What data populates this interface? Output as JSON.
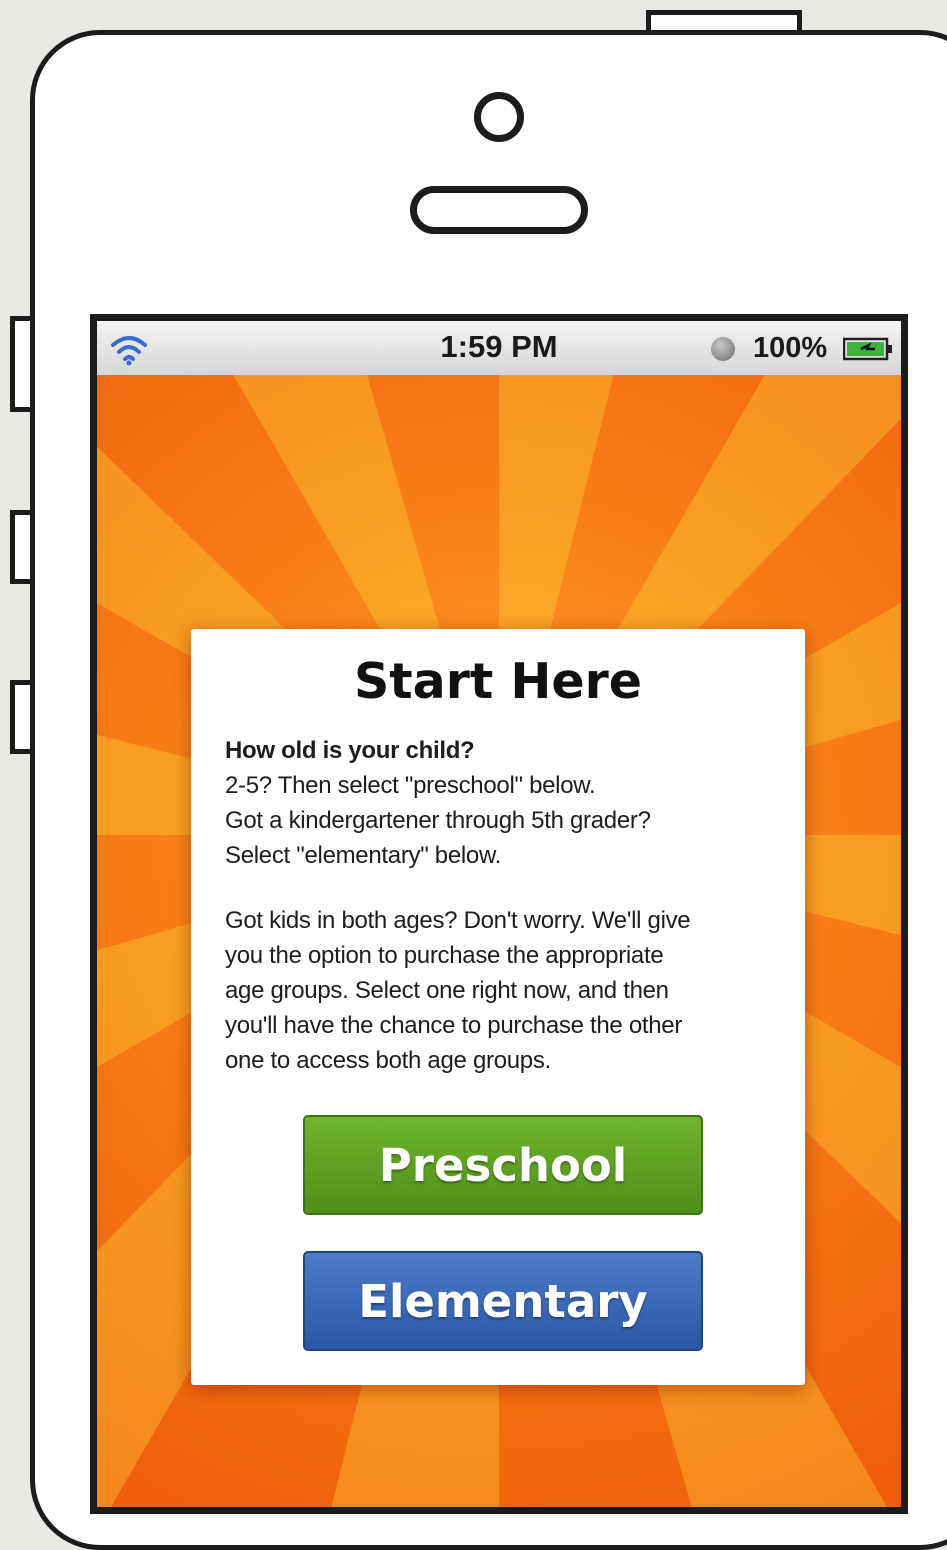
{
  "status_bar": {
    "time": "1:59 PM",
    "battery_percent": "100%",
    "wifi_icon": "wifi-icon",
    "sync_icon": "sync-indicator-icon",
    "battery_icon": "battery-charging-icon"
  },
  "card": {
    "title": "Start Here",
    "question": "How old is your child?",
    "preschool_line": "2-5? Then select \"preschool\" below.",
    "elementary_line_1": "Got a kindergartener through 5th grader?",
    "elementary_line_2": "Select \"elementary\" below.",
    "both_ages_lines": [
      "Got kids in both ages? Don't worry. We'll give",
      "you the option to purchase the appropriate",
      "age groups. Select one right now, and then",
      "you'll have the chance to purchase the other",
      "one to access both age groups."
    ]
  },
  "buttons": {
    "preschool_label": "Preschool",
    "elementary_label": "Elementary"
  },
  "colors": {
    "background_orange": "#f36a10",
    "preschool_green": "#5ca323",
    "elementary_blue": "#3a68b8"
  }
}
